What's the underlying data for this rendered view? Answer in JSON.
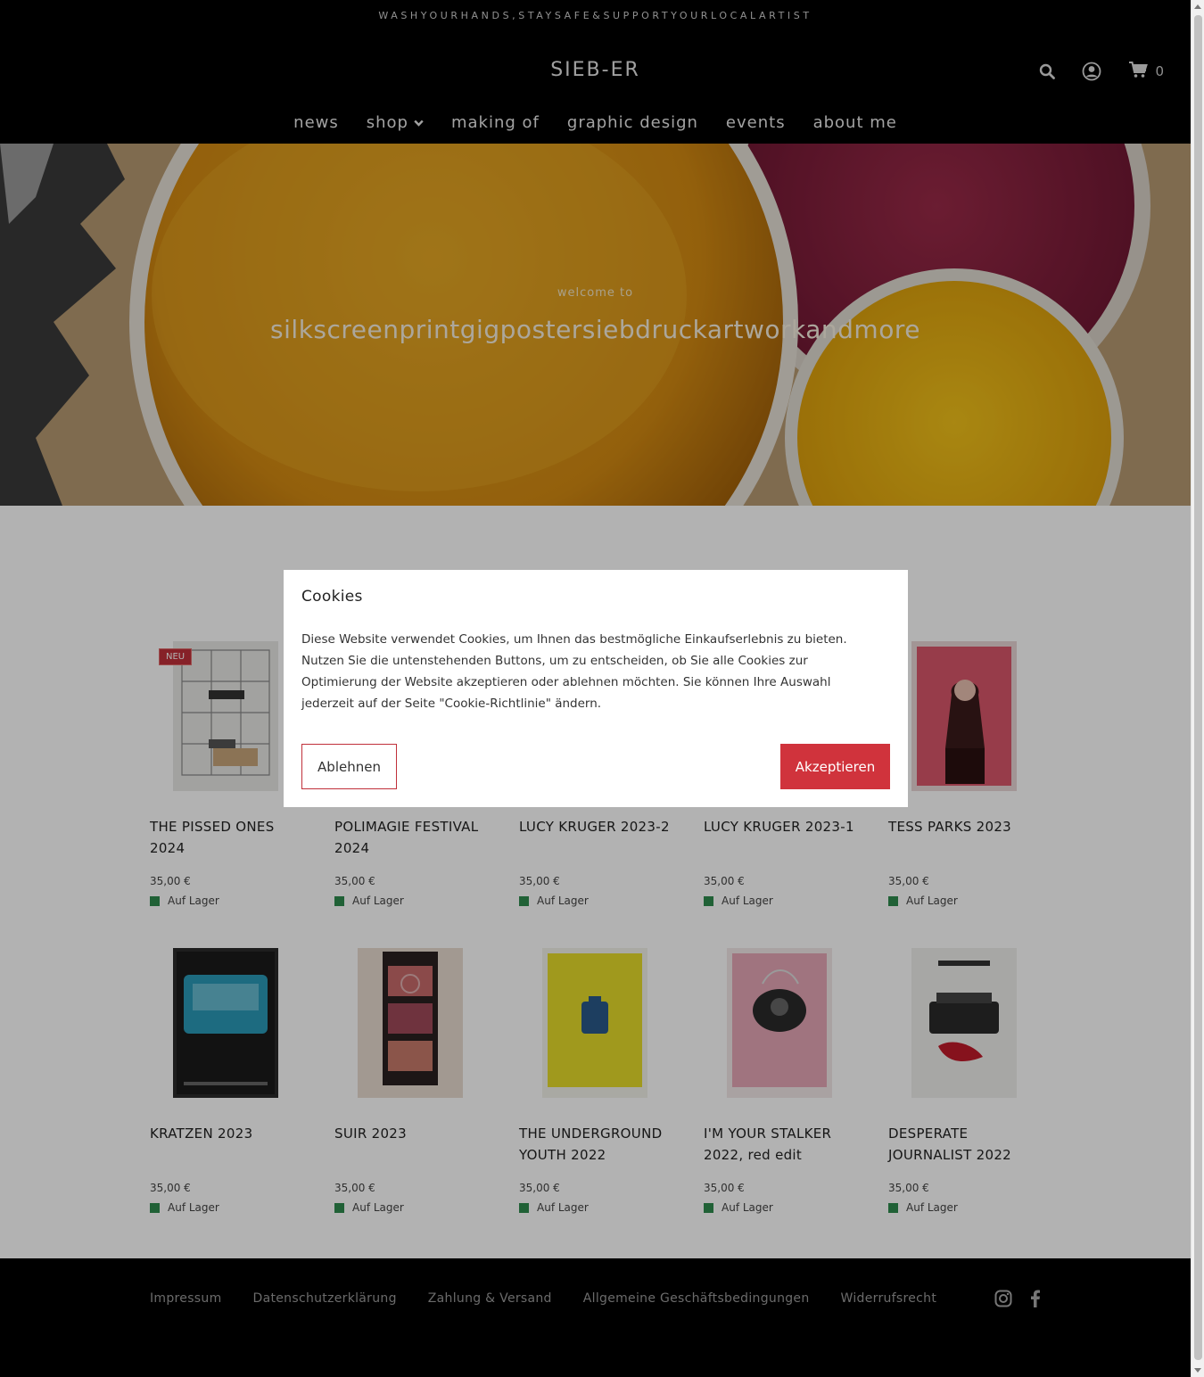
{
  "header": {
    "announcement": "WASHYOURHANDS,STAYSAFE&SUPPORTYOURLOCALARTIST",
    "brand": "SIEB-ER",
    "cart_count": "0",
    "icons": {
      "search": "search-icon",
      "account": "user-circle-icon",
      "cart": "cart-icon"
    },
    "nav": [
      {
        "label": "news"
      },
      {
        "label": "shop",
        "has_dropdown": true
      },
      {
        "label": "making of"
      },
      {
        "label": "graphic design"
      },
      {
        "label": "events"
      },
      {
        "label": "about me"
      }
    ]
  },
  "hero": {
    "subtitle": "welcome to",
    "title": "silkscreenprintgigpostersiebdruckartworkandmore"
  },
  "products": [
    {
      "name": "THE PISSED ONES 2024",
      "price": "35,00 €",
      "stock": "Auf Lager",
      "badge": "NEU"
    },
    {
      "name": "POLIMAGIE FESTIVAL 2024",
      "price": "35,00 €",
      "stock": "Auf Lager"
    },
    {
      "name": "LUCY KRUGER 2023-2",
      "price": "35,00 €",
      "stock": "Auf Lager"
    },
    {
      "name": "LUCY KRUGER 2023-1",
      "price": "35,00 €",
      "stock": "Auf Lager"
    },
    {
      "name": "TESS PARKS 2023",
      "price": "35,00 €",
      "stock": "Auf Lager"
    },
    {
      "name": "KRATZEN 2023",
      "price": "35,00 €",
      "stock": "Auf Lager"
    },
    {
      "name": "SUIR 2023",
      "price": "35,00 €",
      "stock": "Auf Lager"
    },
    {
      "name": "THE UNDERGROUND YOUTH 2022",
      "price": "35,00 €",
      "stock": "Auf Lager"
    },
    {
      "name": "I'M YOUR STALKER 2022, red edit",
      "price": "35,00 €",
      "stock": "Auf Lager"
    },
    {
      "name": "DESPERATE JOURNALIST 2022",
      "price": "35,00 €",
      "stock": "Auf Lager"
    }
  ],
  "footer": {
    "links": [
      "Impressum",
      "Datenschutzerklärung",
      "Zahlung & Versand",
      "Allgemeine Geschäftsbedingungen",
      "Widerrufsrecht"
    ],
    "social": [
      "instagram-icon",
      "facebook-icon"
    ]
  },
  "cookie": {
    "title": "Cookies",
    "text": "Diese Website verwendet Cookies, um Ihnen das bestmögliche Einkaufserlebnis zu bieten. Nutzen Sie die untenstehenden Buttons, um zu entscheiden, ob Sie alle Cookies zur Optimierung der Website akzeptieren oder ablehnen möchten. Sie können Ihre Auswahl jederzeit auf der Seite \"Cookie-Richtlinie\" ändern.",
    "decline": "Ablehnen",
    "accept": "Akzeptieren"
  },
  "colors": {
    "accent": "#d0333c",
    "header_bg": "#000000",
    "stock_green": "#2e8b4e"
  }
}
